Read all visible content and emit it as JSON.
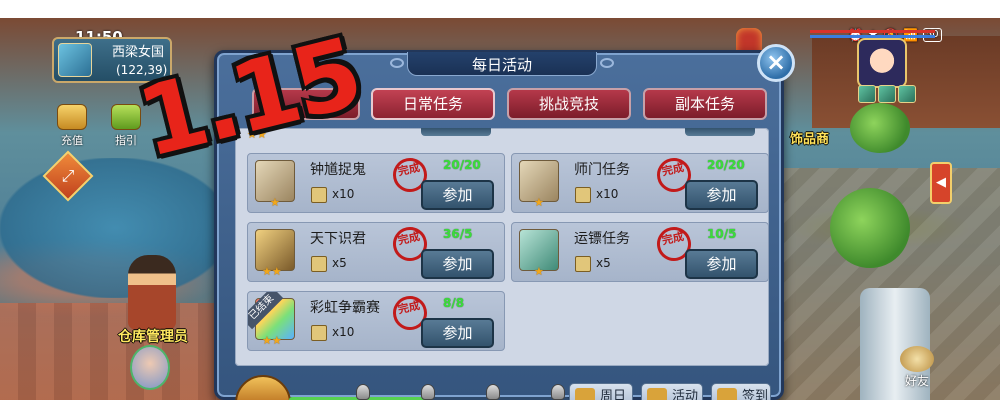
{
  "status_bar": {
    "time": "11:50",
    "battery": "50"
  },
  "hud": {
    "map_name": "西梁女国",
    "coords": "(122,39)",
    "recharge_label": "充值",
    "guide_label": "指引",
    "npc_name": "仓库管理员",
    "shop_label": "饰品商",
    "friends_label": "好友"
  },
  "overlay": {
    "version": "1.15"
  },
  "dialog": {
    "title": "每日活动",
    "close_icon": "×",
    "tabs": [
      "日常任务",
      "挑战竞技",
      "副本任务"
    ],
    "tab_hidden_left_visible": "",
    "activities": [
      {
        "name": "钟馗捉鬼",
        "stars": 1,
        "reward_qty": "x10",
        "seal": "完成",
        "progress": "20/20",
        "join_label": "参加",
        "ended": false
      },
      {
        "name": "师门任务",
        "stars": 1,
        "reward_qty": "x10",
        "seal": "完成",
        "progress": "20/20",
        "join_label": "参加",
        "ended": false
      },
      {
        "name": "天下识君",
        "stars": 2,
        "reward_qty": "x5",
        "seal": "完成",
        "progress": "36/5",
        "join_label": "参加",
        "ended": false
      },
      {
        "name": "运镖任务",
        "stars": 1,
        "reward_qty": "x5",
        "seal": "完成",
        "progress": "10/5",
        "join_label": "参加",
        "ended": false
      },
      {
        "name": "彩虹争霸赛",
        "stars": 2,
        "reward_qty": "x10",
        "seal": "完成",
        "progress": "8/8",
        "join_label": "参加",
        "ended": true,
        "ended_label": "已结束"
      }
    ],
    "bottom_buttons": [
      "周日",
      "活动",
      "签到"
    ],
    "activity_progress": 0.5
  },
  "colors": {
    "seal_red": "#c21a1a",
    "progress_green": "#3bdc3b",
    "tab_red": "#b5394a",
    "version_red": "#e8241a"
  }
}
